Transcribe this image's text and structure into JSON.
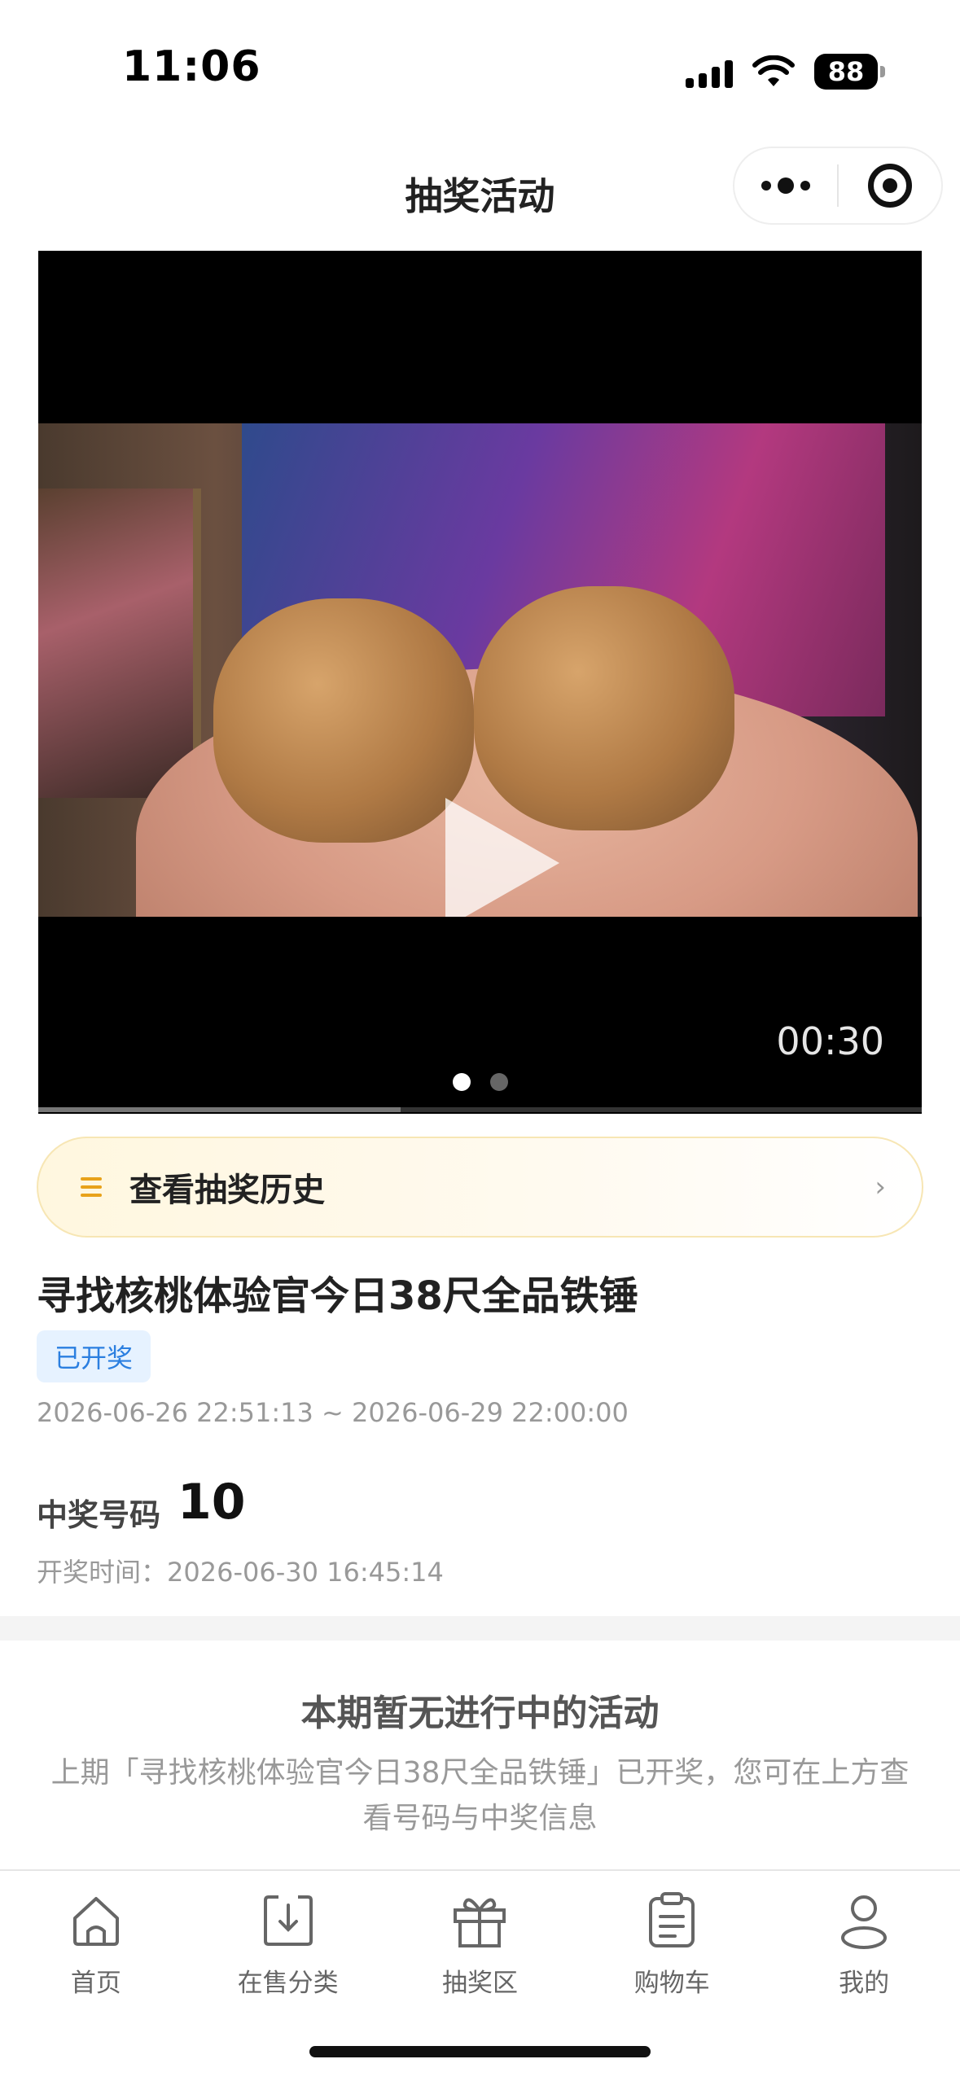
{
  "status_bar": {
    "time": "11:06",
    "battery": "88"
  },
  "nav": {
    "title": "抽奖活动"
  },
  "video": {
    "duration": "00:30",
    "slide_count": 2,
    "active_slide": 1,
    "progress": 0.41
  },
  "history": {
    "label": "查看抽奖历史"
  },
  "activity": {
    "title": "寻找核桃体验官今日38尺全品铁锤",
    "status_badge": "已开奖",
    "period": "2026-06-26 22:51:13 ~ 2026-06-29 22:00:00",
    "winning_label": "中奖号码",
    "winning_number": "10",
    "draw_time": "开奖时间：2026-06-30 16:45:14"
  },
  "empty_state": {
    "title": "本期暂无进行中的活动",
    "description": "上期「寻找核桃体验官今日38尺全品铁锤」已开奖，您可在上方查看号码与中奖信息"
  },
  "tabbar": {
    "items": [
      {
        "label": "首页",
        "icon": "home-icon"
      },
      {
        "label": "在售分类",
        "icon": "category-icon"
      },
      {
        "label": "抽奖区",
        "icon": "gift-icon"
      },
      {
        "label": "购物车",
        "icon": "clipboard-icon"
      },
      {
        "label": "我的",
        "icon": "user-icon"
      }
    ]
  }
}
